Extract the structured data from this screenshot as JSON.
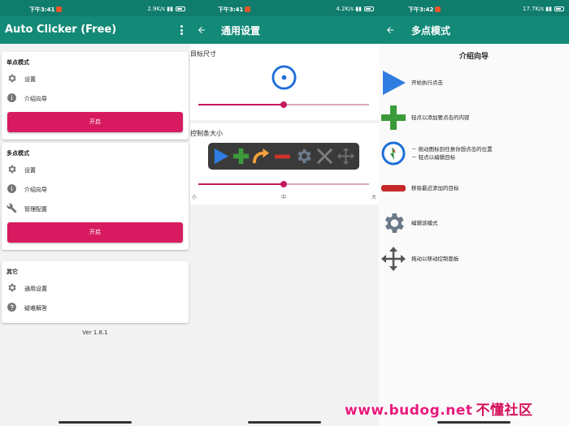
{
  "panel1": {
    "status": {
      "time": "下午3:41",
      "speed": "2.9K/s"
    },
    "title": "Auto Clicker (Free)",
    "single_mode": {
      "header": "单点模式",
      "items": [
        "设置",
        "介绍向导"
      ],
      "button": "开启"
    },
    "multi_mode": {
      "header": "多点模式",
      "items": [
        "设置",
        "介绍向导",
        "管理配置"
      ],
      "button": "开启"
    },
    "other": {
      "header": "其它",
      "items": [
        "通用设置",
        "疑难解答"
      ]
    },
    "version": "Ver 1.6.1"
  },
  "panel2": {
    "status": {
      "time": "下午3:41",
      "speed": "4.2K/s"
    },
    "title": "通用设置",
    "target_size_label": "目标尺寸",
    "target_size_value": 0.5,
    "toolbar_size_label": "控制条大小",
    "toolbar_size_value": 0.5,
    "tick_labels": [
      "小",
      "中",
      "大"
    ]
  },
  "panel3": {
    "status": {
      "time": "下午3:42",
      "speed": "17.7K/s"
    },
    "title": "多点模式",
    "heading": "介绍向导",
    "guide": [
      {
        "icon": "play-icon",
        "lines": [
          "开始执行点击"
        ]
      },
      {
        "icon": "plus-icon",
        "lines": [
          "轻点以添加要点击的内容"
        ]
      },
      {
        "icon": "target-icon",
        "lines": [
          "－ 拖动图标到任意你想点击的位置",
          "－ 轻点以编辑目标"
        ]
      },
      {
        "icon": "minus-icon",
        "lines": [
          "移除最近添加的目标"
        ]
      },
      {
        "icon": "gear-icon",
        "lines": [
          "编辑该模式"
        ]
      },
      {
        "icon": "move-icon",
        "lines": [
          "拖动以移动控制面板"
        ]
      }
    ]
  },
  "watermark": {
    "url": "www.budog.net",
    "name": "不懂社区"
  },
  "colors": {
    "statusbar": "#0f7c6c",
    "appbar": "#138a78",
    "accent": "#d81b60"
  }
}
